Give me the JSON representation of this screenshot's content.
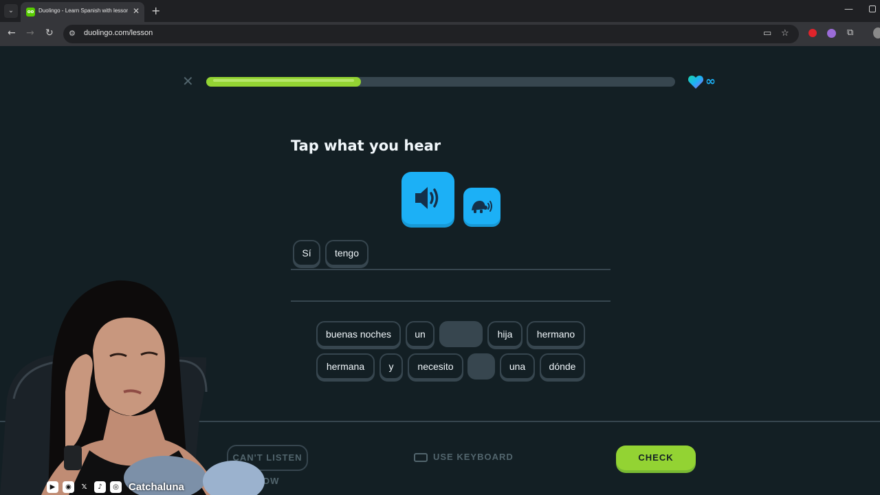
{
  "browser": {
    "tab_title": "Duolingo - Learn Spanish with lessons that wo",
    "tab_favicon": "oo",
    "url": "duolingo.com/lesson",
    "icons": [
      "tab-list-icon",
      "close-icon",
      "new-tab-icon",
      "back-icon",
      "forward-icon",
      "reload-icon",
      "site-info-icon",
      "cast-icon",
      "star-icon",
      "extension-icon",
      "puzzle-icon",
      "profile-icon",
      "minimize-icon",
      "maximize-icon"
    ]
  },
  "lesson": {
    "progress": 0.33,
    "hearts": "∞",
    "prompt": "Tap what you hear",
    "answer_words": [
      "Sí",
      "tengo"
    ],
    "word_bank_row1": [
      "buenas noches",
      "un",
      "",
      "hija",
      "hermano"
    ],
    "word_bank_row2": [
      "hermana",
      "y",
      "necesito",
      "",
      "una",
      "dónde"
    ]
  },
  "footer": {
    "skip_label": "CAN'T LISTEN NOW",
    "skip_visible": "LIST...OW",
    "keyboard_label": "USE KEYBOARD",
    "check_label": "CHECK"
  },
  "overlay": {
    "handle": "Catchaluna",
    "social_icons": [
      "youtube-icon",
      "discord-icon",
      "x-icon",
      "tiktok-icon",
      "instagram-icon"
    ]
  },
  "colors": {
    "background": "#131f24",
    "accent_green": "#93d333",
    "accent_blue": "#1cb0f6",
    "border": "#37464f"
  }
}
